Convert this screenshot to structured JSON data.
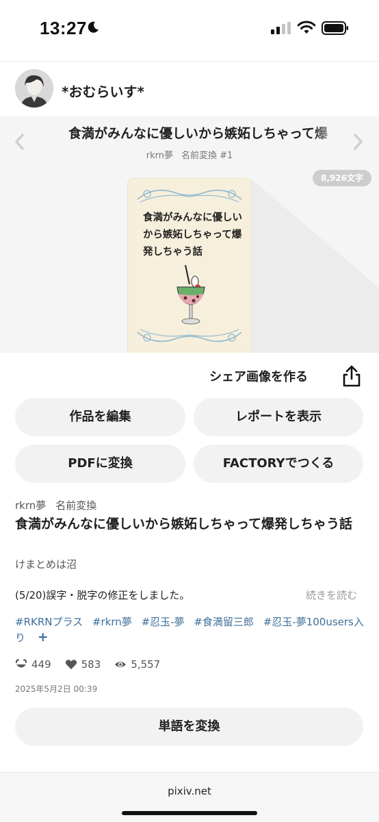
{
  "status_bar": {
    "time": "13:27",
    "icons": [
      "moon-icon",
      "signal-icon",
      "wifi-icon",
      "battery-icon"
    ]
  },
  "author": {
    "name": "*おむらいす*"
  },
  "work": {
    "title_short": "食満がみんなに優しいから嫉妬しちゃって爆",
    "series": "rkrn夢",
    "series_sub": "名前変換 #1",
    "char_count": "8,926文字",
    "cover_text": "食満がみんなに優しいから嫉妬しちゃって爆発しちゃう話"
  },
  "actions": {
    "share_image": "シェア画像を作る",
    "edit": "作品を編集",
    "report": "レポートを表示",
    "pdf": "PDFに変換",
    "factory": "FACTORYでつくる",
    "convert_words": "単語を変換"
  },
  "meta": {
    "series": "rkrn夢",
    "series_sub": "名前変換",
    "title": "食満がみんなに優しいから嫉妬しちゃって爆発しちゃう話",
    "caption": "けまとめは沼",
    "update_note": "(5/20)誤字・脱字の修正をしました。",
    "read_more": "続きを読む",
    "tags": [
      "#RKRNプラス",
      "#rkrn夢",
      "#忍玉-夢",
      "#食満留三郎",
      "#忍玉-夢100users入り"
    ],
    "add_tag": "+",
    "likes": "449",
    "bookmarks": "583",
    "views": "5,557",
    "date": "2025年5月2日 00:39"
  },
  "browser": {
    "url": "pixiv.net"
  },
  "colors": {
    "tag": "#3d6f9a",
    "button_bg": "#f2f2f2",
    "cover_bg": "#f5f5f5",
    "cover_card": "#f6efdc"
  }
}
